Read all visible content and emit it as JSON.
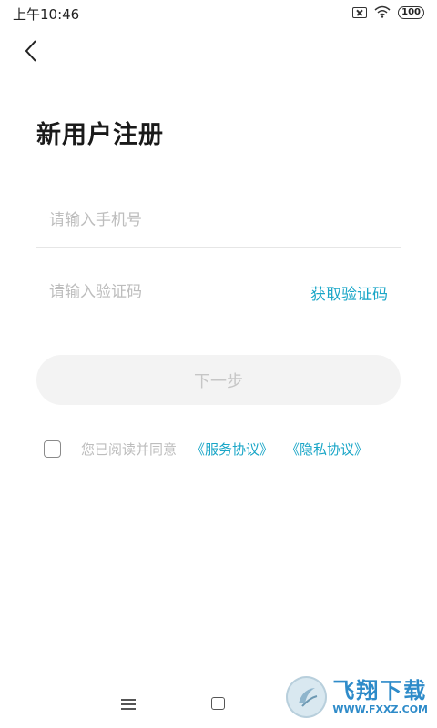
{
  "status_bar": {
    "time": "上午10:46",
    "battery": "100",
    "icons": [
      "sim-off-icon",
      "wifi-icon",
      "battery-icon"
    ]
  },
  "header": {
    "back_icon": "chevron-left-icon"
  },
  "page_title": "新用户注册",
  "form": {
    "phone_placeholder": "请输入手机号",
    "phone_value": "",
    "code_placeholder": "请输入验证码",
    "code_value": "",
    "get_code_label": "获取验证码",
    "next_label": "下一步"
  },
  "agreement": {
    "checked": false,
    "text": "您已阅读并同意",
    "service_link": "《服务协议》",
    "privacy_link": "《隐私协议》"
  },
  "nav_bar": {
    "icons": [
      "menu-icon",
      "home-icon"
    ]
  },
  "watermark": {
    "name": "飞翔下载",
    "url": "WWW.FXXZ.COM"
  },
  "colors": {
    "accent": "#1aa6c7",
    "placeholder": "#bdbdbd",
    "button_bg": "#f3f3f3",
    "button_text": "#c6c6c6",
    "divider": "#e6e6e6",
    "watermark": "#2e8bc9"
  }
}
